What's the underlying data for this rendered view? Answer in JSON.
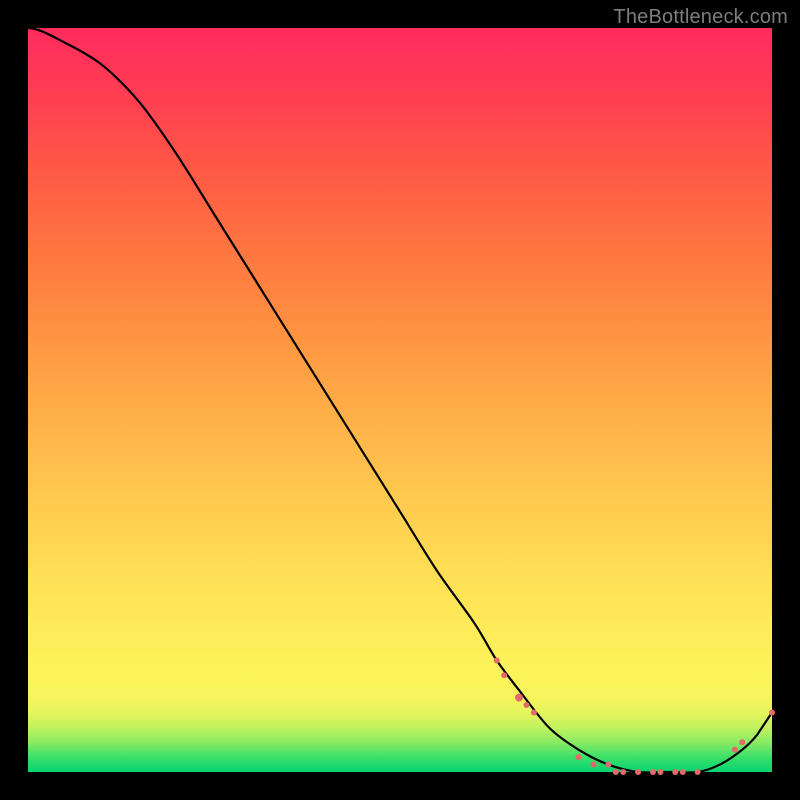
{
  "watermark": "TheBottleneck.com",
  "chart_data": {
    "type": "line",
    "title": "",
    "xlabel": "",
    "ylabel": "",
    "xlim": [
      0,
      100
    ],
    "ylim": [
      0,
      100
    ],
    "grid": false,
    "legend": false,
    "annotations": [],
    "series": [
      {
        "name": "curve",
        "color": "#000000",
        "x": [
          0,
          5,
          10,
          15,
          20,
          25,
          30,
          35,
          40,
          45,
          50,
          55,
          60,
          63,
          66,
          70,
          74,
          78,
          82,
          86,
          90,
          93,
          96,
          98,
          100
        ],
        "y": [
          100,
          98,
          95,
          90,
          83,
          75,
          67,
          59,
          51,
          43,
          35,
          27,
          20,
          15,
          11,
          6,
          3,
          1,
          0,
          0,
          0,
          1,
          3,
          5,
          8
        ]
      },
      {
        "name": "dots",
        "color": "#e26a6a",
        "type": "scatter",
        "points": [
          {
            "x": 63,
            "y": 15,
            "r": 3
          },
          {
            "x": 64,
            "y": 13,
            "r": 3
          },
          {
            "x": 66,
            "y": 10,
            "r": 4
          },
          {
            "x": 67,
            "y": 9,
            "r": 3
          },
          {
            "x": 68,
            "y": 8,
            "r": 3
          },
          {
            "x": 74,
            "y": 2,
            "r": 3
          },
          {
            "x": 76,
            "y": 1,
            "r": 3
          },
          {
            "x": 78,
            "y": 1,
            "r": 3
          },
          {
            "x": 79,
            "y": 0,
            "r": 3
          },
          {
            "x": 80,
            "y": 0,
            "r": 3
          },
          {
            "x": 82,
            "y": 0,
            "r": 3
          },
          {
            "x": 84,
            "y": 0,
            "r": 3
          },
          {
            "x": 85,
            "y": 0,
            "r": 3
          },
          {
            "x": 87,
            "y": 0,
            "r": 3
          },
          {
            "x": 88,
            "y": 0,
            "r": 3
          },
          {
            "x": 90,
            "y": 0,
            "r": 3
          },
          {
            "x": 95,
            "y": 3,
            "r": 3
          },
          {
            "x": 96,
            "y": 4,
            "r": 3
          },
          {
            "x": 100,
            "y": 8,
            "r": 3
          }
        ]
      }
    ]
  }
}
